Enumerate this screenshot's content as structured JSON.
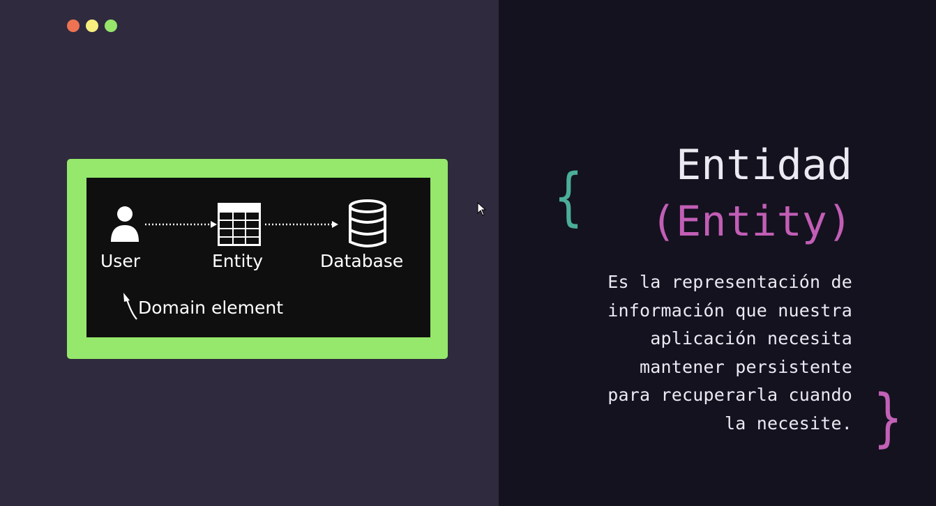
{
  "window": {
    "controls": [
      "close",
      "minimize",
      "maximize"
    ],
    "control_colors": {
      "close": "#ee7352",
      "minimize": "#f7ee7f",
      "maximize": "#97e56b"
    }
  },
  "diagram": {
    "frame_color": "#95e86b",
    "nodes": [
      {
        "id": "user",
        "label": "User",
        "icon": "user-icon"
      },
      {
        "id": "entity",
        "label": "Entity",
        "icon": "table-icon"
      },
      {
        "id": "database",
        "label": "Database",
        "icon": "database-icon"
      }
    ],
    "edges": [
      {
        "from": "user",
        "to": "entity",
        "style": "dotted-arrow"
      },
      {
        "from": "entity",
        "to": "database",
        "style": "dotted-arrow"
      }
    ],
    "annotation": {
      "label": "Domain element",
      "points_to": "user"
    }
  },
  "slide": {
    "title": "Entidad",
    "subtitle": "(Entity)",
    "description": "Es la representación de\ninformación que nuestra\naplicación necesita\nmantener persistente\npara recuperarla cuando\nla necesite.",
    "brace_open": "{",
    "brace_close": "}",
    "colors": {
      "title": "#ebe9f1",
      "subtitle": "#c25eb6",
      "brace_open": "#4bae97",
      "brace_close": "#c261b6"
    }
  }
}
